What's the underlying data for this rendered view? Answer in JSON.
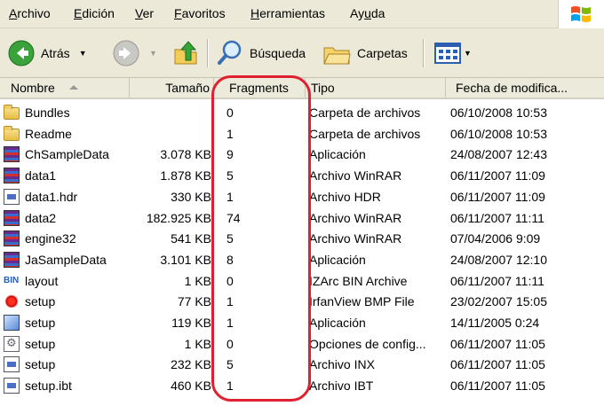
{
  "menu": [
    {
      "pre": "",
      "ul": "A",
      "post": "rchivo"
    },
    {
      "pre": "",
      "ul": "E",
      "post": "dición"
    },
    {
      "pre": "",
      "ul": "V",
      "post": "er"
    },
    {
      "pre": "",
      "ul": "F",
      "post": "avoritos"
    },
    {
      "pre": "",
      "ul": "H",
      "post": "erramientas"
    },
    {
      "pre": "Ay",
      "ul": "u",
      "post": "da"
    }
  ],
  "toolbar": {
    "back_label": "Atrás",
    "search_label": "Búsqueda",
    "folders_label": "Carpetas"
  },
  "columns": {
    "name": "Nombre",
    "size": "Tamaño",
    "fragments": "Fragments",
    "type": "Tipo",
    "date": "Fecha de modifica..."
  },
  "files": [
    {
      "name": "Bundles",
      "size": "",
      "fragments": "0",
      "type": "Carpeta de archivos",
      "date": "06/10/2008 10:53",
      "icon": "folder-icon"
    },
    {
      "name": "Readme",
      "size": "",
      "fragments": "1",
      "type": "Carpeta de archivos",
      "date": "06/10/2008 10:53",
      "icon": "folder-icon"
    },
    {
      "name": "ChSampleData",
      "size": "3.078 KB",
      "fragments": "9",
      "type": "Aplicación",
      "date": "24/08/2007 12:43",
      "icon": "winrar-app-icon"
    },
    {
      "name": "data1",
      "size": "1.878 KB",
      "fragments": "5",
      "type": "Archivo WinRAR",
      "date": "06/11/2007 11:09",
      "icon": "winrar-icon"
    },
    {
      "name": "data1.hdr",
      "size": "330 KB",
      "fragments": "1",
      "type": "Archivo HDR",
      "date": "06/11/2007 11:09",
      "icon": "document-icon"
    },
    {
      "name": "data2",
      "size": "182.925 KB",
      "fragments": "74",
      "type": "Archivo WinRAR",
      "date": "06/11/2007 11:11",
      "icon": "winrar-icon"
    },
    {
      "name": "engine32",
      "size": "541 KB",
      "fragments": "5",
      "type": "Archivo WinRAR",
      "date": "07/04/2006 9:09",
      "icon": "winrar-icon"
    },
    {
      "name": "JaSampleData",
      "size": "3.101 KB",
      "fragments": "8",
      "type": "Aplicación",
      "date": "24/08/2007 12:10",
      "icon": "winrar-app-icon"
    },
    {
      "name": "layout",
      "size": "1 KB",
      "fragments": "0",
      "type": "IZArc BIN Archive",
      "date": "06/11/2007 11:11",
      "icon": "bin-icon"
    },
    {
      "name": "setup",
      "size": "77 KB",
      "fragments": "1",
      "type": "IrfanView BMP File",
      "date": "23/02/2007 15:05",
      "icon": "bmp-icon"
    },
    {
      "name": "setup",
      "size": "119 KB",
      "fragments": "1",
      "type": "Aplicación",
      "date": "14/11/2005 0:24",
      "icon": "setup-app-icon"
    },
    {
      "name": "setup",
      "size": "1 KB",
      "fragments": "0",
      "type": "Opciones de config...",
      "date": "06/11/2007 11:05",
      "icon": "config-icon"
    },
    {
      "name": "setup",
      "size": "232 KB",
      "fragments": "5",
      "type": "Archivo INX",
      "date": "06/11/2007 11:05",
      "icon": "document-icon"
    },
    {
      "name": "setup.ibt",
      "size": "460 KB",
      "fragments": "1",
      "type": "Archivo IBT",
      "date": "06/11/2007 11:05",
      "icon": "document-icon"
    }
  ],
  "colors": {
    "highlight": "#e02030",
    "chrome": "#ece9d8"
  }
}
